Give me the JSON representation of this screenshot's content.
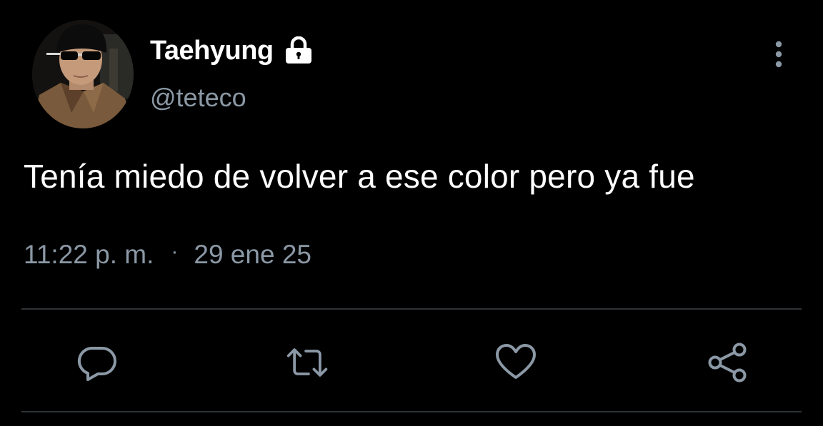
{
  "author": {
    "display_name": "Taehyung",
    "handle": "@teteco",
    "avatar_icon": "profile-photo",
    "lock_icon": "lock-icon"
  },
  "tweet": {
    "text": "Tenía miedo de volver a ese color pero ya fue",
    "time": "11:22 p. m.",
    "separator": "·",
    "date": "29 ene 25"
  },
  "actions": {
    "reply_icon": "reply-icon",
    "retweet_icon": "retweet-icon",
    "like_icon": "heart-icon",
    "share_icon": "share-icon",
    "more_icon": "more-vertical-icon"
  },
  "colors": {
    "background": "#000000",
    "text_primary": "#ffffff",
    "text_secondary": "#8b98a5",
    "divider": "#2f3336"
  }
}
